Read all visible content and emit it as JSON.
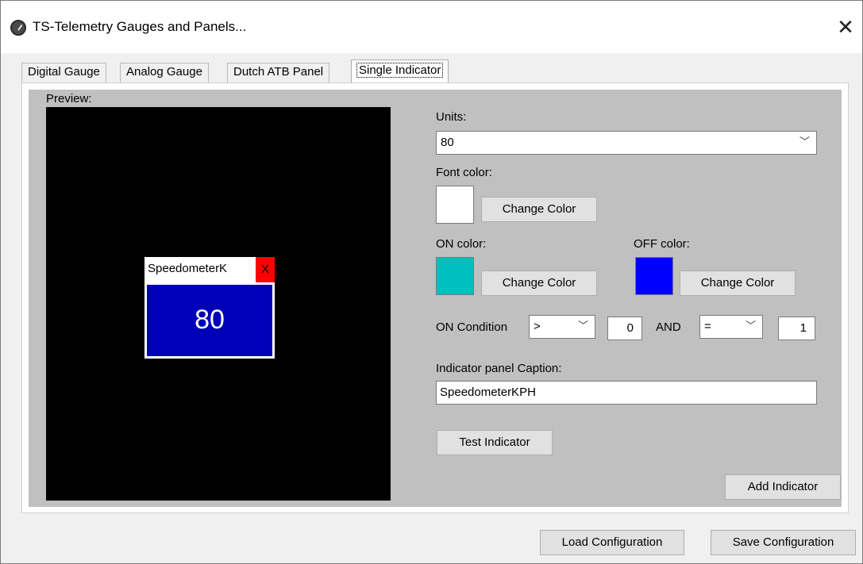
{
  "window": {
    "title": "TS-Telemetry Gauges and Panels...",
    "close_glyph": "✕"
  },
  "tabs": [
    {
      "label": "Digital Gauge"
    },
    {
      "label": "Analog Gauge"
    },
    {
      "label": "Dutch ATB Panel"
    },
    {
      "label": "Single Indicator",
      "active": true
    }
  ],
  "preview": {
    "label": "Preview:",
    "indicator": {
      "caption": "SpeedometerK",
      "close_label": "X",
      "value": "80",
      "body_color": "#0000b8",
      "close_color": "#ff0000"
    }
  },
  "units": {
    "label": "Units:",
    "value": "80"
  },
  "font_color": {
    "label": "Font color:",
    "swatch": "#ffffff",
    "button": "Change Color"
  },
  "on_color": {
    "label": "ON color:",
    "swatch": "#00bfbf",
    "button": "Change Color"
  },
  "off_color": {
    "label": "OFF color:",
    "swatch": "#0000ff",
    "button": "Change Color"
  },
  "condition": {
    "label": "ON Condition",
    "op1": ">",
    "value1": "0",
    "joiner": "AND",
    "op2": "=",
    "value2": "1"
  },
  "caption": {
    "label": "Indicator panel Caption:",
    "value": "SpeedometerKPH"
  },
  "buttons": {
    "test": "Test Indicator",
    "add": "Add Indicator",
    "load": "Load Configuration",
    "save": "Save Configuration"
  }
}
